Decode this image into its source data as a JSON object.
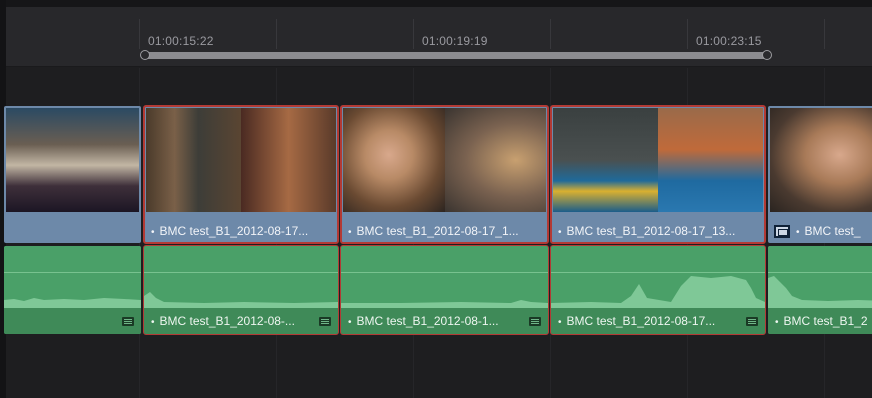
{
  "ruler": {
    "timecodes": [
      "01:00:15:22",
      "01:00:19:19",
      "01:00:23:15"
    ]
  },
  "video_clips": [
    {
      "label": ""
    },
    {
      "label": "BMC test_B1_2012-08-17..."
    },
    {
      "label": "BMC test_B1_2012-08-17_1..."
    },
    {
      "label": "BMC test_B1_2012-08-17_13..."
    },
    {
      "label": "BMC test_"
    }
  ],
  "audio_clips": [
    {
      "label": ""
    },
    {
      "label": "BMC test_B1_2012-08-..."
    },
    {
      "label": "BMC test_B1_2012-08-1..."
    },
    {
      "label": "BMC test_B1_2012-08-17..."
    },
    {
      "label": "BMC test_B1_2"
    }
  ],
  "colors": {
    "video_clip": "#6d89a9",
    "audio_clip": "#4e9f6a",
    "selection_outline": "#b33a35"
  }
}
